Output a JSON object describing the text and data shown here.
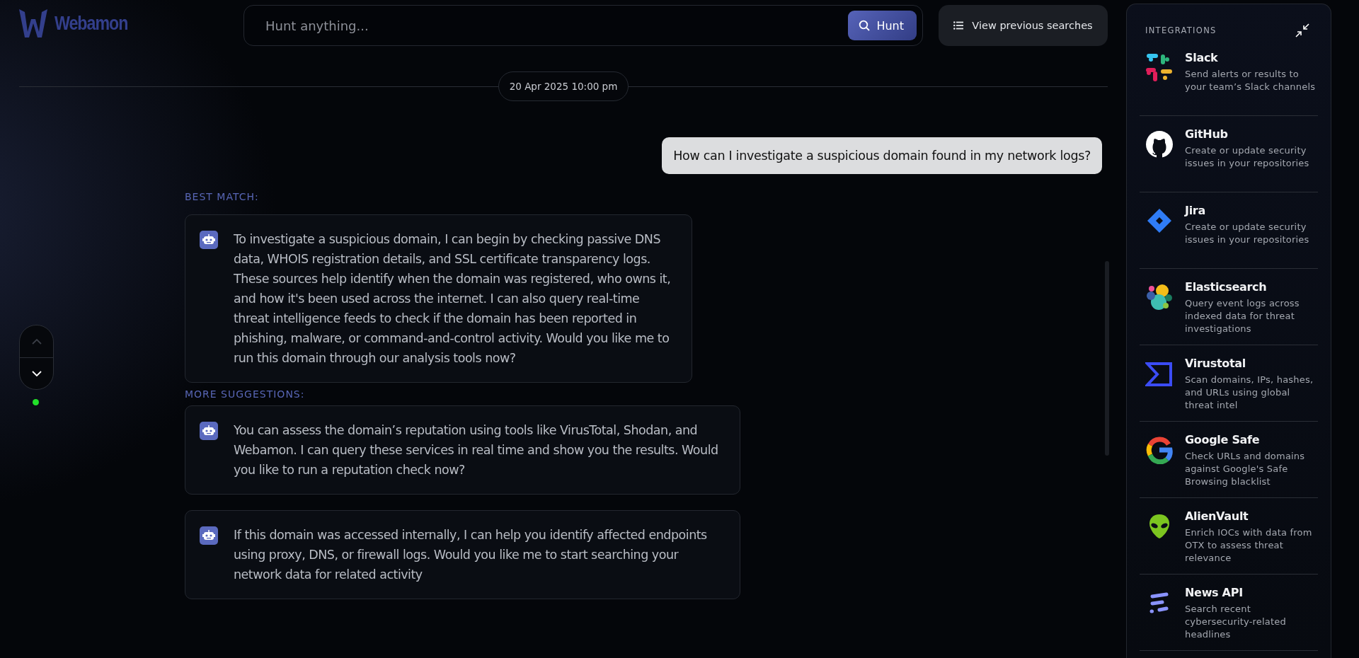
{
  "logo": {
    "text": "Webamon"
  },
  "search": {
    "placeholder": "Hunt anything...",
    "button": "Hunt"
  },
  "history_button": "View previous searches",
  "timestamp": "20 Apr 2025 10:00 pm",
  "user_message": "How can I investigate a suspicious domain found in my network logs?",
  "best_match": {
    "heading": "BEST MATCH:",
    "text": "To investigate a suspicious domain, I can begin by checking passive DNS data, WHOIS registration details, and SSL certificate transparency logs. These sources help identify when the domain was registered, who owns it, and how it's been used across the internet. I can also query real-time threat intelligence feeds to check if the domain has been reported in phishing, malware, or command-and-control activity. Would you like me to run this domain through our analysis tools now?"
  },
  "suggestions": {
    "heading": "MORE SUGGESTIONS:",
    "items": [
      {
        "text": "You can assess the domain’s reputation using tools like VirusTotal, Shodan, and Webamon. I can query these services in real time and show you the results. Would you like to run a reputation check now?"
      },
      {
        "text": "If this domain was accessed internally, I can help you identify affected endpoints using proxy, DNS, or firewall logs. Would you like me to start searching your network data for related activity"
      }
    ]
  },
  "scroll_nav": {
    "up": {
      "disabled": true
    },
    "down": {
      "disabled": false
    }
  },
  "status": {
    "online": true
  },
  "integrations": {
    "title": "INTEGRATIONS",
    "items": [
      {
        "kind": "slack",
        "name": "Slack",
        "description": "Send alerts or results to your team’s Slack channels"
      },
      {
        "kind": "github",
        "name": "GitHub",
        "description": "Create or update security issues in your repositories"
      },
      {
        "kind": "jira",
        "name": "Jira",
        "description": "Create or update security issues in your repositories"
      },
      {
        "kind": "elastic",
        "name": "Elasticsearch",
        "description": "Query event logs across indexed data for threat investigations"
      },
      {
        "kind": "virustotal",
        "name": "Virustotal",
        "description": "Scan domains, IPs, hashes, and URLs using global threat intel"
      },
      {
        "kind": "google",
        "name": "Google Safe",
        "description": "Check URLs and domains against Google's Safe Browsing blacklist"
      },
      {
        "kind": "alienvault",
        "name": "AlienVault",
        "description": "Enrich IOCs with data from OTX to assess threat relevance"
      },
      {
        "kind": "newsapi",
        "name": "News API",
        "description": "Search recent cybersecurity-related headlines"
      }
    ]
  }
}
